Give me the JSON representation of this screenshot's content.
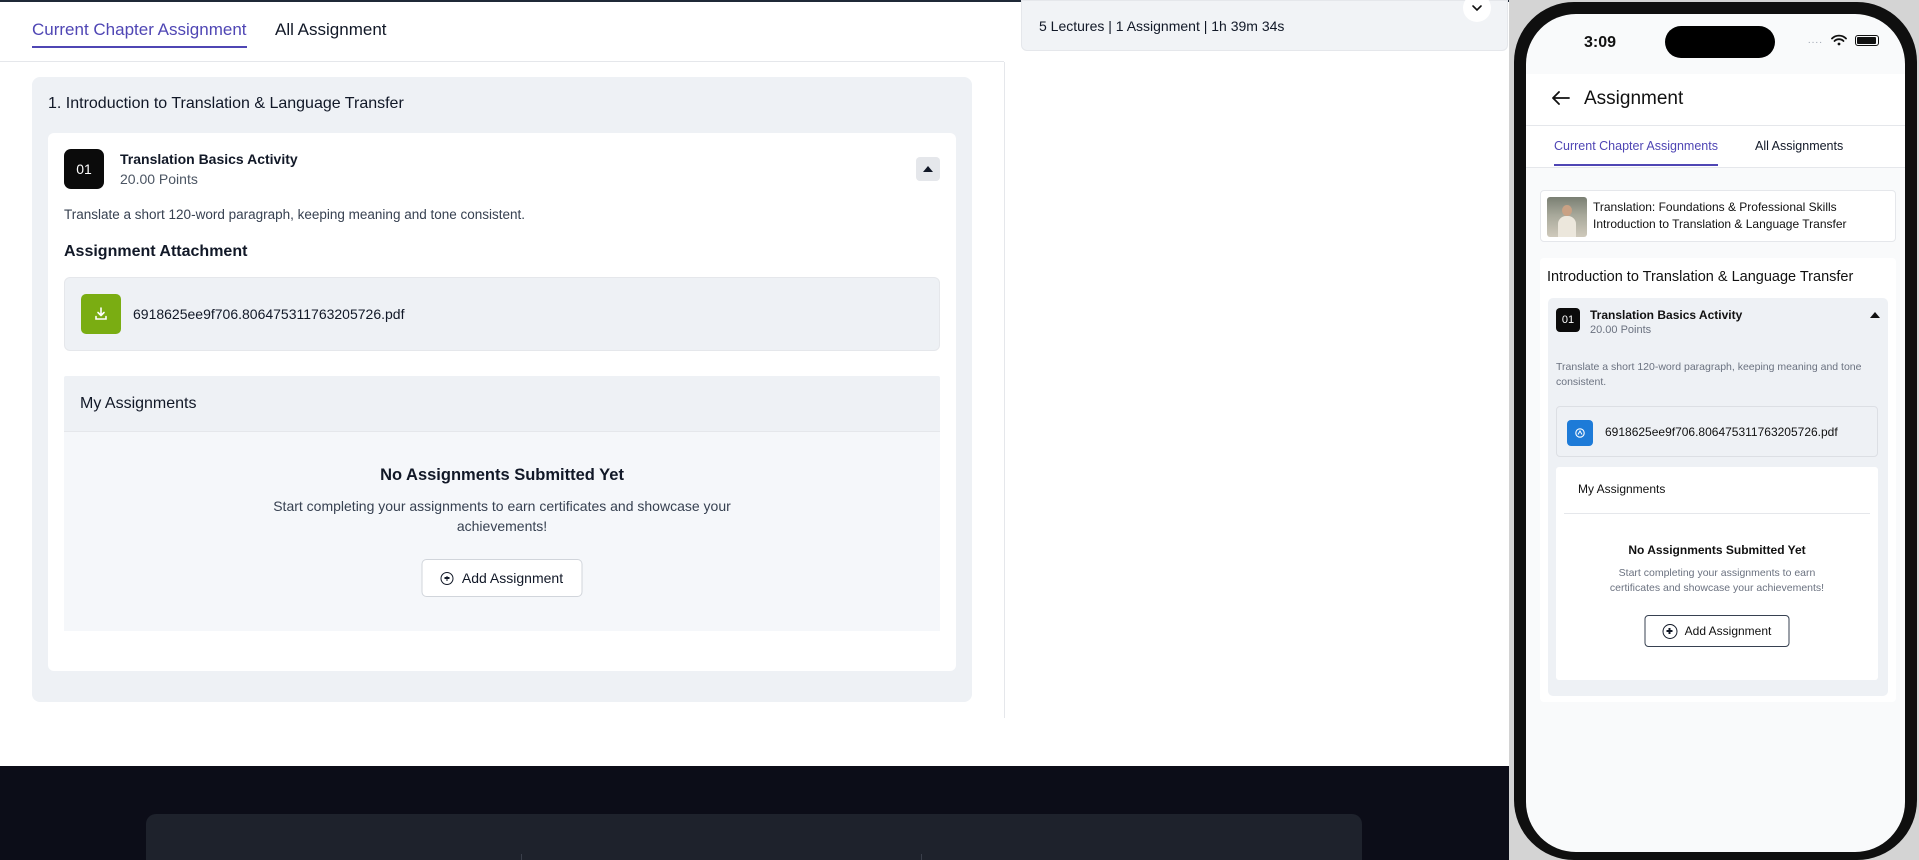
{
  "desktop": {
    "tabs": {
      "current": "Current Chapter Assignment",
      "all": "All Assignment"
    },
    "summary": "5 Lectures | 1 Assignment | 1h 39m 34s",
    "chapter": {
      "title": "1. Introduction to Translation & Language Transfer",
      "assignment": {
        "number": "01",
        "title": "Translation Basics Activity",
        "points": "20.00 Points",
        "description": "Translate a short 120-word paragraph, keeping meaning and tone consistent.",
        "attachment_heading": "Assignment Attachment",
        "attachment_file": "6918625ee9f706.806475311763205726.pdf"
      },
      "my_assignments": {
        "heading": "My Assignments",
        "empty_title": "No Assignments Submitted Yet",
        "empty_desc": "Start completing your assignments to earn certificates and showcase your achievements!",
        "add_label": "Add Assignment"
      }
    }
  },
  "phone": {
    "status_time": "3:09",
    "status_dots": "....",
    "header_title": "Assignment",
    "tabs": {
      "current": "Current Chapter Assignments",
      "all": "All Assignments"
    },
    "course": {
      "name": "Translation: Foundations & Professional Skills",
      "chapter": "Introduction to Translation & Language Transfer"
    },
    "chapter_title": "Introduction to Translation & Language Transfer",
    "assignment": {
      "number": "01",
      "title": "Translation Basics Activity",
      "points": "20.00 Points",
      "description": "Translate a short 120-word paragraph, keeping meaning and tone consistent.",
      "attachment_file": "6918625ee9f706.806475311763205726.pdf"
    },
    "my_assignments": {
      "heading": "My Assignments",
      "empty_title": "No Assignments Submitted Yet",
      "empty_desc": "Start completing your assignments to earn certificates and showcase your achievements!",
      "add_label": "Add Assignment"
    }
  },
  "icons": {
    "download": "download-icon",
    "plus": "plus-circle-icon",
    "collapse": "chevron-up-icon",
    "expand": "chevron-down-icon",
    "back": "back-arrow-icon",
    "wifi": "wifi-icon",
    "battery": "battery-icon",
    "pdf": "pdf-icon"
  },
  "colors": {
    "accent": "#4f46b4",
    "download_green": "#7aad12",
    "pdf_blue": "#1d7bd8",
    "footer_dark": "#0c0d18"
  }
}
